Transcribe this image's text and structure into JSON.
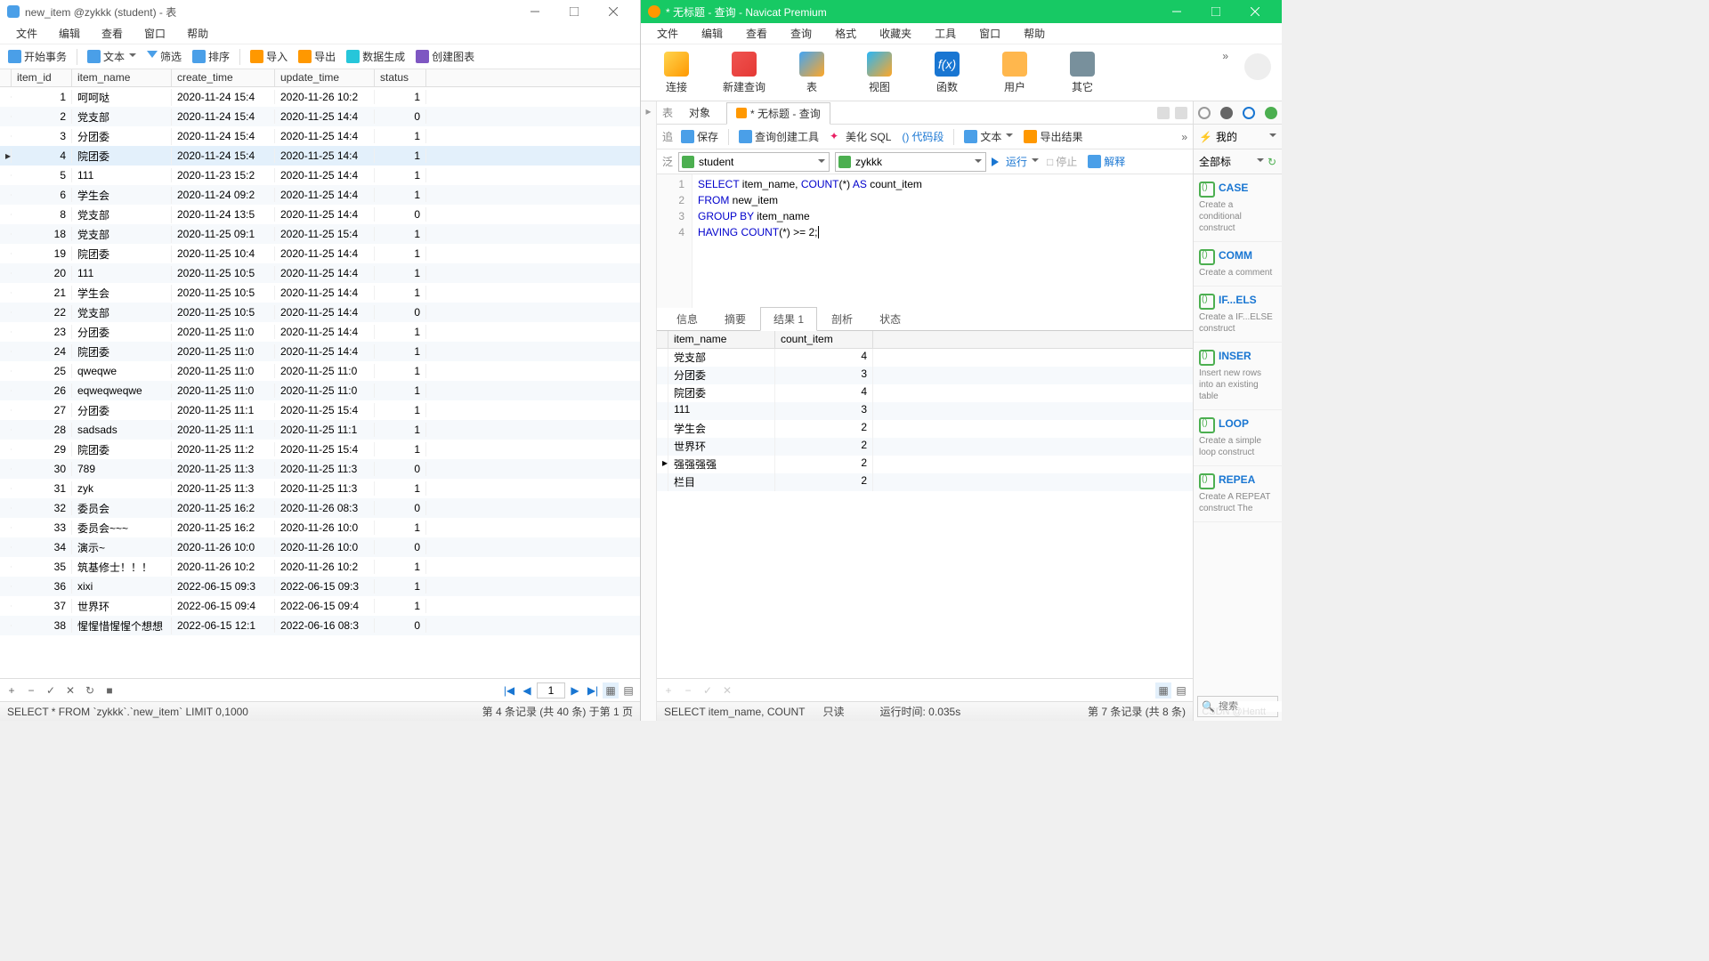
{
  "left": {
    "title": "new_item @zykkk (student) - 表",
    "menu": [
      "文件",
      "编辑",
      "查看",
      "窗口",
      "帮助"
    ],
    "toolbar": {
      "begin": "开始事务",
      "text": "文本",
      "filter": "筛选",
      "sort": "排序",
      "import": "导入",
      "export": "导出",
      "gen": "数据生成",
      "chart": "创建图表"
    },
    "columns": [
      "item_id",
      "item_name",
      "create_time",
      "update_time",
      "status"
    ],
    "selected_row_index": 3,
    "rows": [
      {
        "id": 1,
        "name": "呵呵哒",
        "ct": "2020-11-24 15:4",
        "ut": "2020-11-26 10:2",
        "st": 1
      },
      {
        "id": 2,
        "name": "党支部",
        "ct": "2020-11-24 15:4",
        "ut": "2020-11-25 14:4",
        "st": 0
      },
      {
        "id": 3,
        "name": "分团委",
        "ct": "2020-11-24 15:4",
        "ut": "2020-11-25 14:4",
        "st": 1
      },
      {
        "id": 4,
        "name": "院团委",
        "ct": "2020-11-24 15:4",
        "ut": "2020-11-25 14:4",
        "st": 1
      },
      {
        "id": 5,
        "name": "111",
        "ct": "2020-11-23 15:2",
        "ut": "2020-11-25 14:4",
        "st": 1
      },
      {
        "id": 6,
        "name": "学生会",
        "ct": "2020-11-24 09:2",
        "ut": "2020-11-25 14:4",
        "st": 1
      },
      {
        "id": 8,
        "name": "党支部",
        "ct": "2020-11-24 13:5",
        "ut": "2020-11-25 14:4",
        "st": 0
      },
      {
        "id": 18,
        "name": "党支部",
        "ct": "2020-11-25 09:1",
        "ut": "2020-11-25 15:4",
        "st": 1
      },
      {
        "id": 19,
        "name": "院团委",
        "ct": "2020-11-25 10:4",
        "ut": "2020-11-25 14:4",
        "st": 1
      },
      {
        "id": 20,
        "name": "111",
        "ct": "2020-11-25 10:5",
        "ut": "2020-11-25 14:4",
        "st": 1
      },
      {
        "id": 21,
        "name": "学生会",
        "ct": "2020-11-25 10:5",
        "ut": "2020-11-25 14:4",
        "st": 1
      },
      {
        "id": 22,
        "name": "党支部",
        "ct": "2020-11-25 10:5",
        "ut": "2020-11-25 14:4",
        "st": 0
      },
      {
        "id": 23,
        "name": "分团委",
        "ct": "2020-11-25 11:0",
        "ut": "2020-11-25 14:4",
        "st": 1
      },
      {
        "id": 24,
        "name": "院团委",
        "ct": "2020-11-25 11:0",
        "ut": "2020-11-25 14:4",
        "st": 1
      },
      {
        "id": 25,
        "name": "qweqwe",
        "ct": "2020-11-25 11:0",
        "ut": "2020-11-25 11:0",
        "st": 1
      },
      {
        "id": 26,
        "name": "eqweqweqwe",
        "ct": "2020-11-25 11:0",
        "ut": "2020-11-25 11:0",
        "st": 1
      },
      {
        "id": 27,
        "name": "分团委",
        "ct": "2020-11-25 11:1",
        "ut": "2020-11-25 15:4",
        "st": 1
      },
      {
        "id": 28,
        "name": "sadsads",
        "ct": "2020-11-25 11:1",
        "ut": "2020-11-25 11:1",
        "st": 1
      },
      {
        "id": 29,
        "name": "院团委",
        "ct": "2020-11-25 11:2",
        "ut": "2020-11-25 15:4",
        "st": 1
      },
      {
        "id": 30,
        "name": "789",
        "ct": "2020-11-25 11:3",
        "ut": "2020-11-25 11:3",
        "st": 0
      },
      {
        "id": 31,
        "name": "zyk",
        "ct": "2020-11-25 11:3",
        "ut": "2020-11-25 11:3",
        "st": 1
      },
      {
        "id": 32,
        "name": "委员会",
        "ct": "2020-11-25 16:2",
        "ut": "2020-11-26 08:3",
        "st": 0
      },
      {
        "id": 33,
        "name": "委员会~~~",
        "ct": "2020-11-25 16:2",
        "ut": "2020-11-26 10:0",
        "st": 1
      },
      {
        "id": 34,
        "name": "演示~",
        "ct": "2020-11-26 10:0",
        "ut": "2020-11-26 10:0",
        "st": 0
      },
      {
        "id": 35,
        "name": "筑基修士！！！",
        "ct": "2020-11-26 10:2",
        "ut": "2020-11-26 10:2",
        "st": 1
      },
      {
        "id": 36,
        "name": "xixi",
        "ct": "2022-06-15 09:3",
        "ut": "2022-06-15 09:3",
        "st": 1
      },
      {
        "id": 37,
        "name": "世界环",
        "ct": "2022-06-15 09:4",
        "ut": "2022-06-15 09:4",
        "st": 1
      },
      {
        "id": 38,
        "name": "惺惺惜惺惺个想想",
        "ct": "2022-06-15 12:1",
        "ut": "2022-06-16 08:3",
        "st": 0
      }
    ],
    "paging": {
      "page": "1"
    },
    "status": {
      "sql": "SELECT * FROM `zykkk`.`new_item` LIMIT 0,1000",
      "rec": "第 4 条记录  (共 40 条)  于第 1 页"
    }
  },
  "right": {
    "title": "* 无标题 - 查询 - Navicat Premium",
    "menu": [
      "文件",
      "编辑",
      "查看",
      "查询",
      "格式",
      "收藏夹",
      "工具",
      "窗口",
      "帮助"
    ],
    "bigbtns": {
      "conn": "连接",
      "newq": "新建查询",
      "table": "表",
      "view": "视图",
      "func": "函数",
      "user": "用户",
      "other": "其它"
    },
    "tabs": {
      "obj": "对象",
      "q": "* 无标题 - 查询"
    },
    "edtoolbar": {
      "save": "保存",
      "builder": "查询创建工具",
      "beautify": "美化 SQL",
      "codeseg": "代码段",
      "text": "文本",
      "export": "导出结果"
    },
    "combos": {
      "conn": "student",
      "db": "zykkk"
    },
    "runbar": {
      "run": "运行",
      "stop": "停止",
      "explain": "解释"
    },
    "sql": {
      "l1a": "SELECT",
      "l1b": " item_name, ",
      "l1c": "COUNT",
      "l1d": "(*) ",
      "l1e": "AS",
      "l1f": " count_item",
      "l2a": "FROM",
      "l2b": " new_item",
      "l3a": "GROUP BY",
      "l3b": " item_name",
      "l4a": "HAVING",
      "l4b": " ",
      "l4c": "COUNT",
      "l4d": "(*) >= 2;"
    },
    "restabs": {
      "info": "信息",
      "summary": "摘要",
      "result": "结果 1",
      "profile": "剖析",
      "status": "状态"
    },
    "rescols": [
      "item_name",
      "count_item"
    ],
    "resrows": [
      {
        "n": "党支部",
        "c": 4
      },
      {
        "n": "分团委",
        "c": 3
      },
      {
        "n": "院团委",
        "c": 4
      },
      {
        "n": "111",
        "c": 3
      },
      {
        "n": "学生会",
        "c": 2
      },
      {
        "n": "世界环",
        "c": 2
      },
      {
        "n": "强强强强",
        "c": 2
      },
      {
        "n": "栏目",
        "c": 2
      }
    ],
    "res_selected_index": 6,
    "status": {
      "sql": "SELECT item_name, COUNT",
      "ro": "只读",
      "time": "运行时间: 0.035s",
      "rec": "第 7 条记录  (共 8 条)"
    },
    "rp": {
      "my": "我的",
      "all": "全部标",
      "search": "搜索",
      "snips": [
        {
          "t": "CASE",
          "d": "Create a conditional construct"
        },
        {
          "t": "COMM",
          "d": "Create a comment"
        },
        {
          "t": "IF...ELS",
          "d": "Create a IF...ELSE construct"
        },
        {
          "t": "INSER",
          "d": "Insert new rows into an existing table"
        },
        {
          "t": "LOOP",
          "d": "Create a simple loop construct"
        },
        {
          "t": "REPEA",
          "d": "Create A REPEAT construct The"
        }
      ]
    }
  }
}
